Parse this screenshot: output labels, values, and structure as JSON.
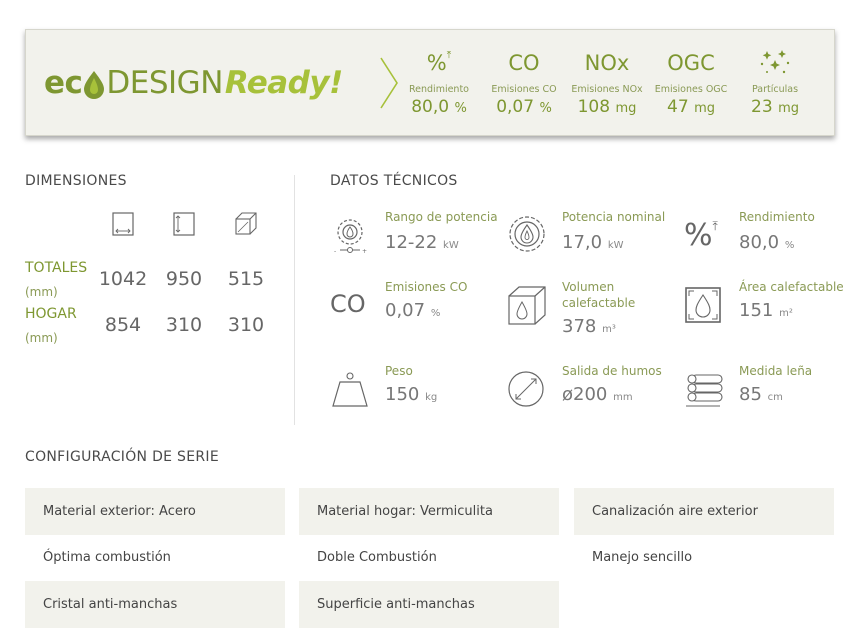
{
  "banner": {
    "logo": {
      "eco": "ec",
      "design": "DESIGN",
      "ready": "Ready!"
    },
    "metrics": [
      {
        "symbol": "%",
        "label": "Rendimiento",
        "value": "80,0",
        "unit": "%"
      },
      {
        "symbol": "CO",
        "label": "Emisiones CO",
        "value": "0,07",
        "unit": "%"
      },
      {
        "symbol": "NOx",
        "label": "Emisiones NOx",
        "value": "108",
        "unit": "mg"
      },
      {
        "symbol": "OGC",
        "label": "Emisiones OGC",
        "value": "47",
        "unit": "mg"
      },
      {
        "symbol": "",
        "label": "Partículas",
        "value": "23",
        "unit": "mg"
      }
    ]
  },
  "dimensions": {
    "title": "DIMENSIONES",
    "rows": [
      {
        "label": "TOTALES",
        "unit": "(mm)",
        "values": [
          "1042",
          "950",
          "515"
        ]
      },
      {
        "label": "HOGAR",
        "unit": "(mm)",
        "values": [
          "854",
          "310",
          "310"
        ]
      }
    ]
  },
  "tech": {
    "title": "DATOS TÉCNICOS",
    "items": [
      {
        "label": "Rango de potencia",
        "value": "12-22",
        "unit": "kW",
        "icon": "power-range-icon"
      },
      {
        "label": "Potencia nominal",
        "value": "17,0",
        "unit": "kW",
        "icon": "flame-circle-icon"
      },
      {
        "label": "Rendimiento",
        "value": "80,0",
        "unit": "%",
        "icon": "efficiency-icon"
      },
      {
        "label": "Emisiones CO",
        "value": "0,07",
        "unit": "%",
        "icon": "co-icon"
      },
      {
        "label": "Volumen",
        "label2": "calefactable",
        "value": "378",
        "unit": "m³",
        "icon": "volume-cube-icon"
      },
      {
        "label": "Área calefactable",
        "value": "151",
        "unit": "m²",
        "icon": "area-icon"
      },
      {
        "label": "Peso",
        "value": "150",
        "unit": "kg",
        "icon": "weight-icon"
      },
      {
        "label": "Salida de humos",
        "value": "ø200",
        "unit": "mm",
        "icon": "flue-diameter-icon"
      },
      {
        "label": "Medida leña",
        "value": "85",
        "unit": "cm",
        "icon": "firewood-icon"
      }
    ]
  },
  "config": {
    "title": "CONFIGURACIÓN DE SERIE",
    "items": [
      "Material exterior: Acero",
      "Material hogar: Vermiculita",
      "Canalización aire exterior",
      "Óptima combustión",
      "Doble Combustión",
      "Manejo sencillo",
      "Cristal anti-manchas",
      "Superficie anti-manchas"
    ]
  },
  "colors": {
    "accent": "#7e9731",
    "accent_light": "#a7c13a",
    "panel": "#f2f2ec"
  }
}
